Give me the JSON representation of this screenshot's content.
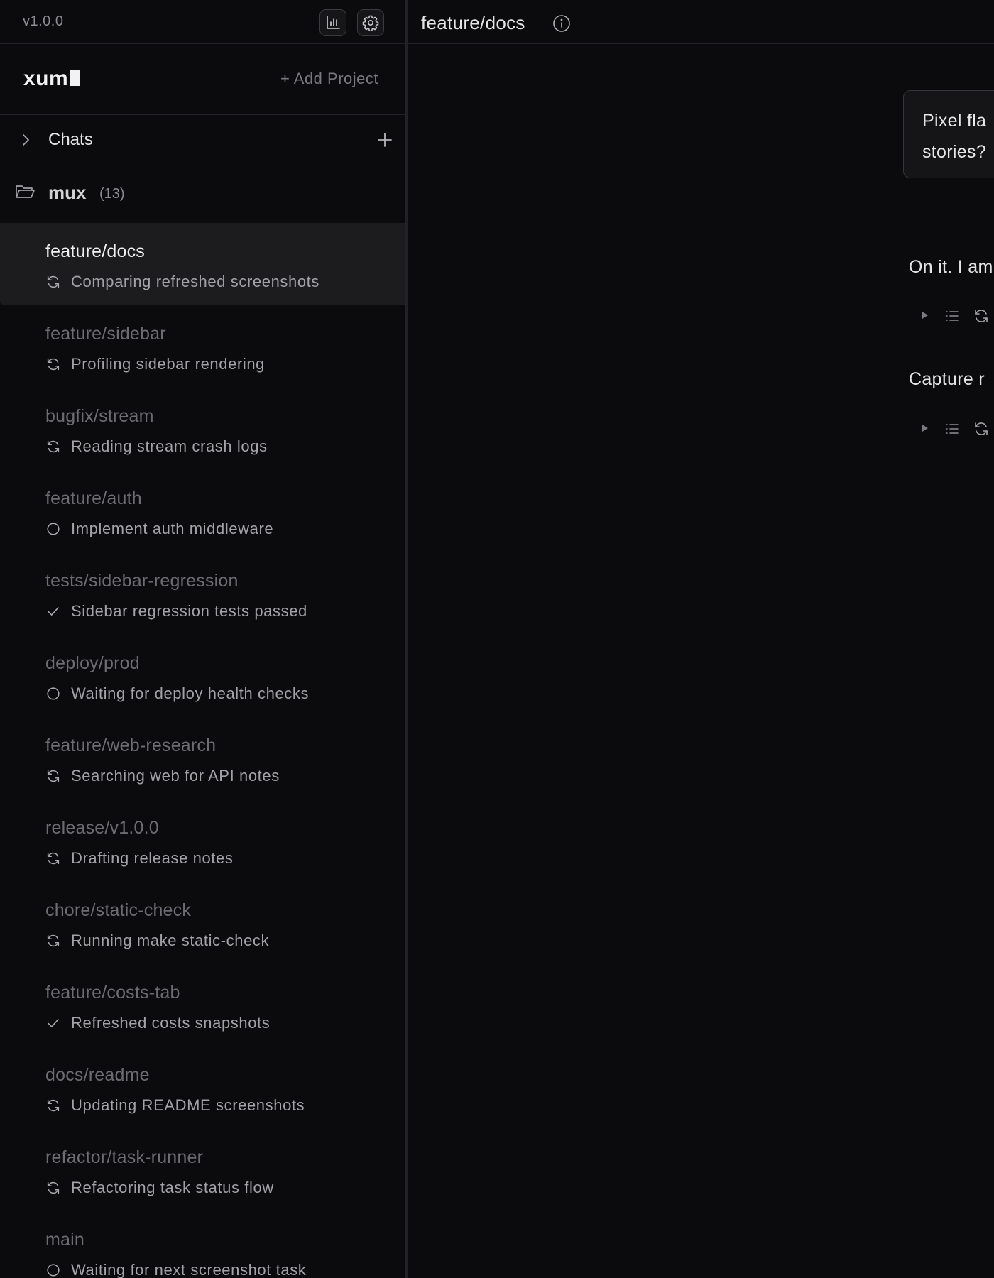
{
  "sidebar": {
    "version": "v1.0.0",
    "logo": "xum",
    "add_project": "+ Add Project",
    "chats_label": "Chats",
    "project": {
      "name": "mux",
      "count": "(13)"
    },
    "workspaces": [
      {
        "name": "feature/docs",
        "status": "Comparing refreshed screenshots",
        "status_icon": "sync-icon",
        "active": true
      },
      {
        "name": "feature/sidebar",
        "status": "Profiling sidebar rendering",
        "status_icon": "sync-icon"
      },
      {
        "name": "bugfix/stream",
        "status": "Reading stream crash logs",
        "status_icon": "sync-icon"
      },
      {
        "name": "feature/auth",
        "status": "Implement auth middleware",
        "status_icon": "circle-icon"
      },
      {
        "name": "tests/sidebar-regression",
        "status": "Sidebar regression tests passed",
        "status_icon": "check-icon"
      },
      {
        "name": "deploy/prod",
        "status": "Waiting for deploy health checks",
        "status_icon": "circle-icon"
      },
      {
        "name": "feature/web-research",
        "status": "Searching web for API notes",
        "status_icon": "sync-icon"
      },
      {
        "name": "release/v1.0.0",
        "status": "Drafting release notes",
        "status_icon": "sync-icon"
      },
      {
        "name": "chore/static-check",
        "status": "Running make static-check",
        "status_icon": "sync-icon"
      },
      {
        "name": "feature/costs-tab",
        "status": "Refreshed costs snapshots",
        "status_icon": "check-icon"
      },
      {
        "name": "docs/readme",
        "status": "Updating README screenshots",
        "status_icon": "sync-icon"
      },
      {
        "name": "refactor/task-runner",
        "status": "Refactoring task status flow",
        "status_icon": "sync-icon"
      },
      {
        "name": "main",
        "status": "Waiting for next screenshot task",
        "status_icon": "circle-icon"
      }
    ]
  },
  "main": {
    "title": "feature/docs",
    "user_message": "Pixel fla\nstories?",
    "assistant_lines": [
      "On it. I am",
      "Capture r"
    ]
  },
  "colors": {
    "background": "#0b0b0d",
    "active_row": "#1c1c1f",
    "muted_text": "#6c6c72",
    "status_text": "#a2a2a7"
  }
}
